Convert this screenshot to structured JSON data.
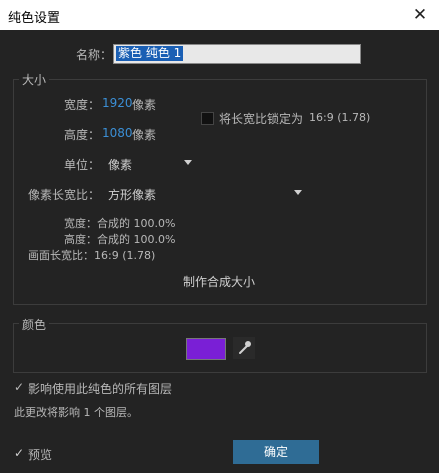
{
  "window": {
    "title": "纯色设置",
    "close_glyph": "✕"
  },
  "name": {
    "label": "名称：",
    "value": "紫色 纯色 1"
  },
  "size": {
    "title": "大小",
    "width_label": "宽度：",
    "width_value": "1920",
    "width_unit": "像素",
    "height_label": "高度：",
    "height_value": "1080",
    "height_unit": "像素",
    "lock_label": "将长宽比锁定为",
    "lock_ratio": "16:9 (1.78)",
    "lock_checked": false,
    "unit_label": "单位：",
    "unit_value": "像素",
    "par_label": "像素长宽比：",
    "par_value": "方形像素",
    "comp_width": "宽度：合成的 100.0%",
    "comp_height": "高度：合成的 100.0%",
    "frame_aspect": "画面长宽比：16:9 (1.78)",
    "make_comp_size_button": "制作合成大小"
  },
  "color": {
    "title": "颜色",
    "swatch": "#7a1fd6",
    "eyedropper_icon": "eyedropper-icon"
  },
  "affect_all": {
    "label": "影响使用此纯色的所有图层",
    "checked": true
  },
  "affect_info": "此更改将影响 1 个图层。",
  "preview": {
    "label": "预览",
    "checked": true
  },
  "ok_button": "确定",
  "colors": {
    "background": "#232323",
    "accent": "#3b8fd6",
    "ok_button": "#2f6c95"
  }
}
